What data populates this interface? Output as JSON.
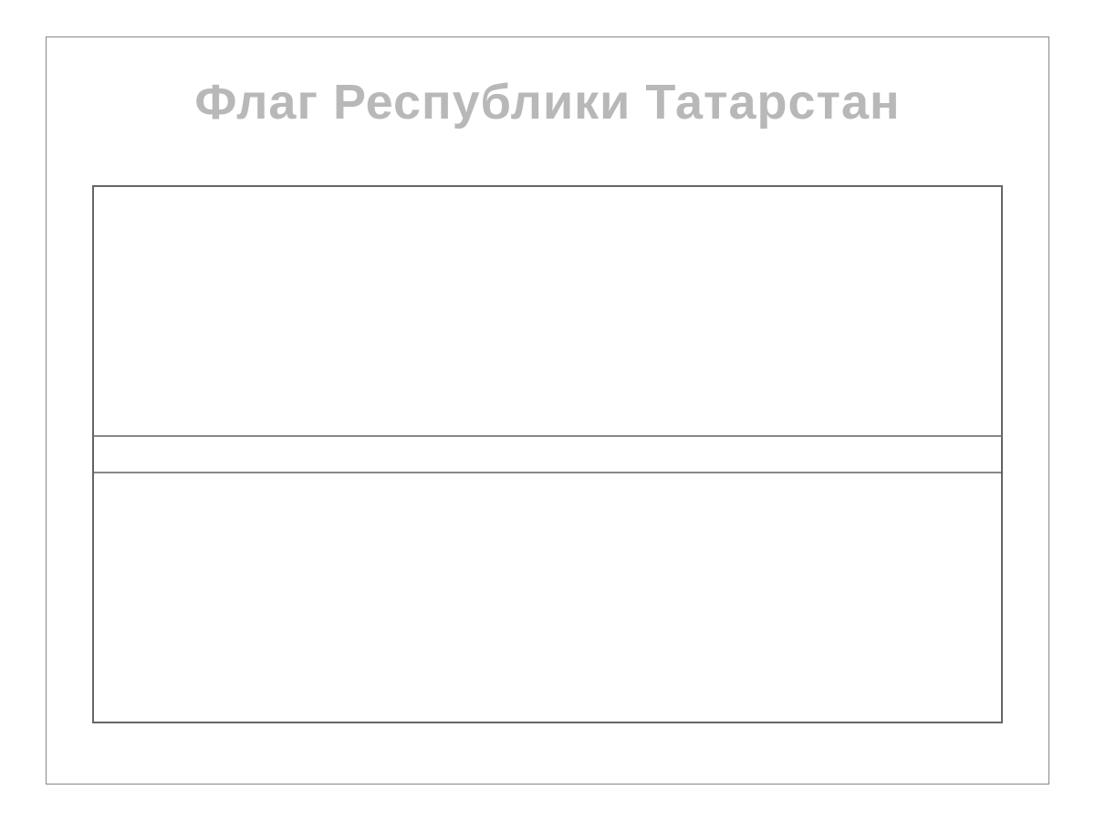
{
  "title": "Флаг Республики Татарстан",
  "flag": {
    "stripes": [
      {
        "name": "top",
        "color": "#ffffff"
      },
      {
        "name": "middle",
        "color": "#ffffff"
      },
      {
        "name": "bottom",
        "color": "#ffffff"
      }
    ]
  }
}
